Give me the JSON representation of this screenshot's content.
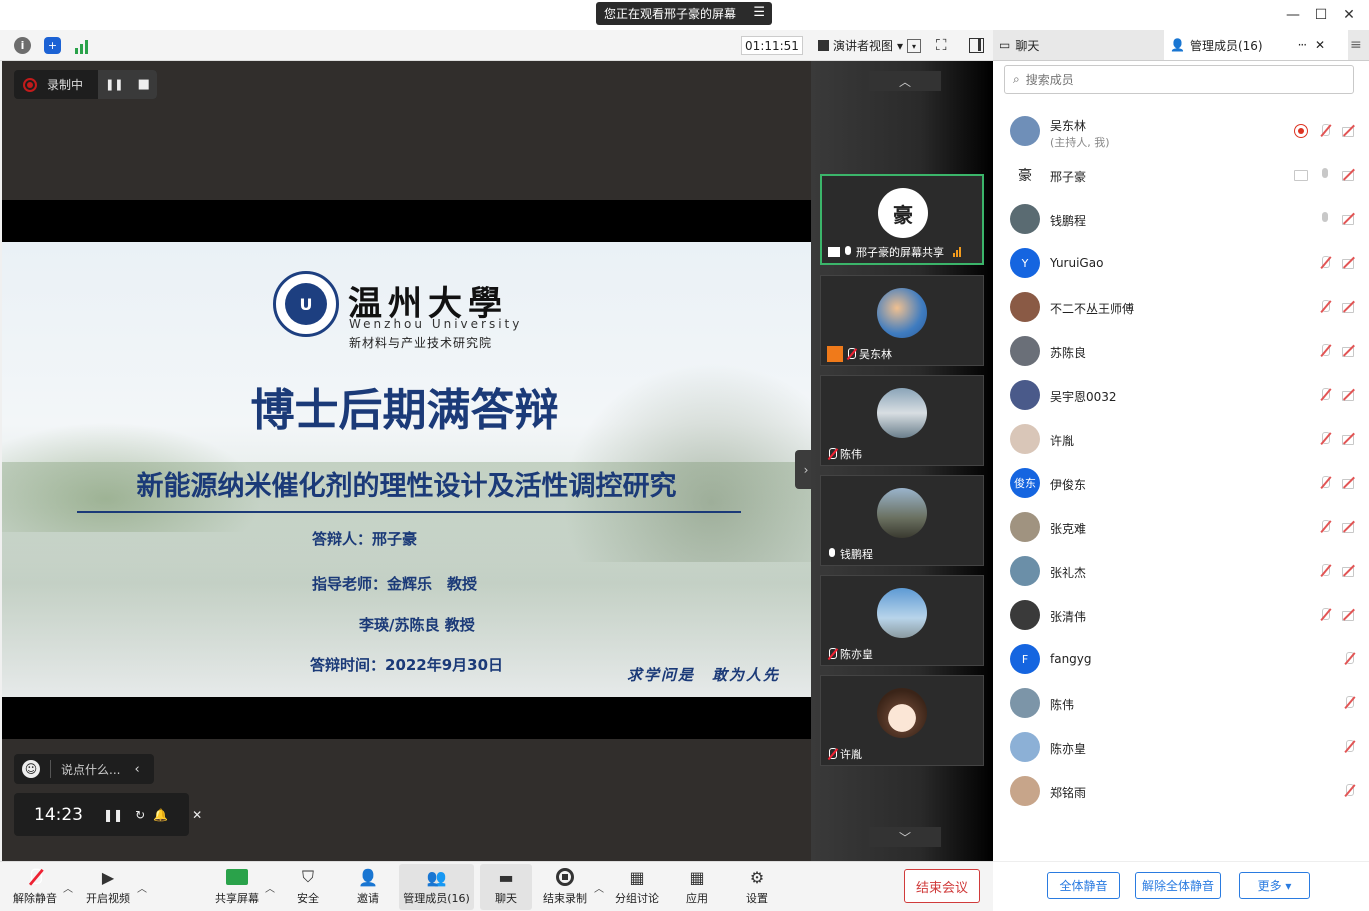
{
  "window": {
    "share_notice": "您正在观看邢子豪的屏幕",
    "menu_glyph": "☰",
    "minimize_glyph": "—",
    "maximize_glyph": "☐",
    "close_glyph": "✕"
  },
  "toolbar": {
    "timer": "01:11:51",
    "view_label": "演讲者视图",
    "view_caret": "▾",
    "fullscreen_glyph": "⛶"
  },
  "tabs": {
    "chat_label": "聊天",
    "members_label": "管理成员(16)",
    "more_glyph": "···",
    "close_glyph": "✕",
    "menu_glyph": "≡"
  },
  "recording": {
    "label": "录制中",
    "pause_glyph": "❚❚",
    "stop_glyph": "■"
  },
  "slide": {
    "logo_cn": "温州大學",
    "logo_en": "Wenzhou University",
    "logo_sub": "新材料与产业技术研究院",
    "logo_mark": "U",
    "title": "博士后期满答辩",
    "subtitle": "新能源纳米催化剂的理性设计及活性调控研究",
    "presenter": "答辩人：邢子豪",
    "advisor1": "指导老师：金辉乐　教授",
    "advisor2": "李瑛/苏陈良  教授",
    "date": "答辩时间：2022年9月30日",
    "motto": "求学问是　敢为人先"
  },
  "chat_bubble": {
    "emoji": "☺",
    "placeholder": "说点什么...",
    "arrow": "‹"
  },
  "countdown": {
    "time": "14:23",
    "pause": "❚❚",
    "reset": "↻",
    "bell": "🔔",
    "close": "✕"
  },
  "strip": {
    "up": "︿",
    "down": "﹀",
    "collapse": "›",
    "thumbs": [
      {
        "name": "邢子豪的屏幕共享",
        "mic": "on",
        "active": true,
        "avatar": "豪",
        "bars": true
      },
      {
        "name": "吴东林",
        "mic": "off",
        "active": false,
        "avatar": "",
        "host": true
      },
      {
        "name": "陈伟",
        "mic": "off",
        "active": false,
        "avatar": ""
      },
      {
        "name": "钱鹏程",
        "mic": "on",
        "active": false,
        "avatar": ""
      },
      {
        "name": "陈亦皇",
        "mic": "off",
        "active": false,
        "avatar": ""
      },
      {
        "name": "许胤",
        "mic": "off",
        "active": false,
        "avatar": ""
      }
    ]
  },
  "bottombar": {
    "unmute": "解除静音",
    "video": "开启视频",
    "share": "共享屏幕",
    "security": "安全",
    "invite": "邀请",
    "members": "管理成员(16)",
    "chat": "聊天",
    "end_record": "结束录制",
    "breakout": "分组讨论",
    "apps": "应用",
    "settings": "设置",
    "end_meeting": "结束会议",
    "caret": "︿"
  },
  "panel": {
    "search_placeholder": "搜索成员",
    "members": [
      {
        "name": "吴东林",
        "role": "(主持人, 我)",
        "avatar_color": "#6f8fb8",
        "avatar_text": "",
        "rec": true,
        "mic": "off",
        "cam": "off"
      },
      {
        "name": "邢子豪",
        "avatar_color": "#ffffff",
        "avatar_text": "豪",
        "share": true,
        "mic": "on",
        "cam": "off"
      },
      {
        "name": "钱鹏程",
        "avatar_color": "#5a6b72",
        "avatar_text": "",
        "mic": "on",
        "cam": "off"
      },
      {
        "name": "YuruiGao",
        "avatar_color": "#1565e0",
        "avatar_text": "Y",
        "mic": "off",
        "cam": "off"
      },
      {
        "name": "不二不丛王师傅",
        "avatar_color": "#8a5a45",
        "avatar_text": "",
        "mic": "off",
        "cam": "off"
      },
      {
        "name": "苏陈良",
        "avatar_color": "#6a6f78",
        "avatar_text": "",
        "mic": "off",
        "cam": "off"
      },
      {
        "name": "吴宇恩0032",
        "avatar_color": "#4a5a8a",
        "avatar_text": "",
        "mic": "off",
        "cam": "off"
      },
      {
        "name": "许胤",
        "avatar_color": "#d9c6b8",
        "avatar_text": "",
        "mic": "off",
        "cam": "off"
      },
      {
        "name": "伊俊东",
        "avatar_color": "#1565e0",
        "avatar_text": "俊东",
        "mic": "off",
        "cam": "off"
      },
      {
        "name": "张克难",
        "avatar_color": "#a09380",
        "avatar_text": "",
        "mic": "off",
        "cam": "off"
      },
      {
        "name": "张礼杰",
        "avatar_color": "#6b8fa8",
        "avatar_text": "",
        "mic": "off",
        "cam": "off"
      },
      {
        "name": "张清伟",
        "avatar_color": "#3a3a3a",
        "avatar_text": "",
        "mic": "off",
        "cam": "off"
      },
      {
        "name": "fangyg",
        "avatar_color": "#1565e0",
        "avatar_text": "F",
        "mic": "off"
      },
      {
        "name": "陈伟",
        "avatar_color": "#7c95a8",
        "avatar_text": "",
        "mic": "off"
      },
      {
        "name": "陈亦皇",
        "avatar_color": "#8cb0d6",
        "avatar_text": "",
        "mic": "off"
      },
      {
        "name": "郑铭雨",
        "avatar_color": "#c7a58a",
        "avatar_text": "",
        "mic": "off"
      }
    ],
    "mute_all": "全体静音",
    "unmute_all": "解除全体静音",
    "more": "更多 ▾"
  },
  "colors": {
    "accent": "#2a7be0",
    "danger": "#d03b3b",
    "active_green": "#3bb56a",
    "slide_blue": "#1b3a78"
  }
}
